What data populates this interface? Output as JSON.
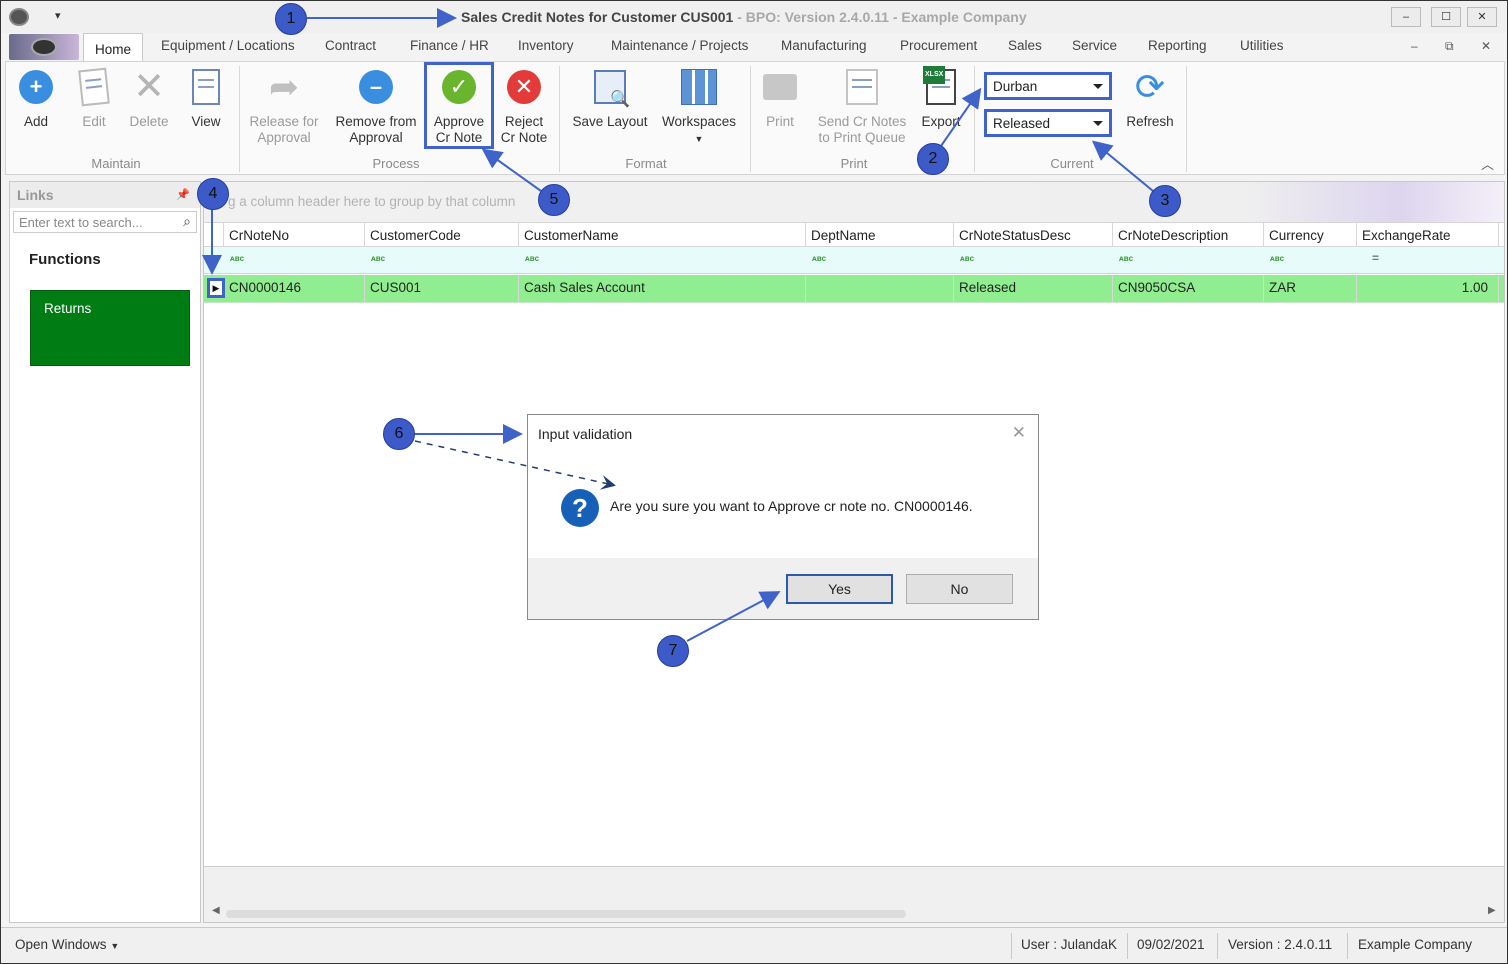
{
  "window": {
    "title_main": "Sales Credit Notes for Customer CUS001",
    "title_rest": " - BPO: Version 2.4.0.11 - Example Company",
    "quick_access": "▾",
    "controls": [
      "–",
      "☐",
      "✕"
    ]
  },
  "tabs": [
    "Home",
    "Equipment / Locations",
    "Contract",
    "Finance / HR",
    "Inventory",
    "Maintenance / Projects",
    "Manufacturing",
    "Procurement",
    "Sales",
    "Service",
    "Reporting",
    "Utilities"
  ],
  "mdi_controls": [
    "–",
    "⧉",
    "✕"
  ],
  "ribbon": {
    "maintain": {
      "label": "Maintain",
      "add": "Add",
      "edit": "Edit",
      "delete": "Delete",
      "view": "View"
    },
    "process": {
      "label": "Process",
      "release_1": "Release for",
      "release_2": "Approval",
      "remove_1": "Remove from",
      "remove_2": "Approval",
      "approve_1": "Approve",
      "approve_2": "Cr Note",
      "reject_1": "Reject",
      "reject_2": "Cr Note"
    },
    "format": {
      "label": "Format",
      "save_layout": "Save Layout",
      "workspaces": "Workspaces"
    },
    "print": {
      "label": "Print",
      "print": "Print",
      "send_1": "Send Cr Notes",
      "send_2": "to Print Queue",
      "export": "Export",
      "xlsx": "XLSX"
    },
    "current": {
      "label": "Current",
      "site": "Durban",
      "status": "Released",
      "refresh": "Refresh"
    }
  },
  "links": {
    "header": "Links",
    "search_placeholder": "Enter text to search...",
    "functions": "Functions",
    "returns": "Returns"
  },
  "grid": {
    "group_hint": "g a column header here to group by that column",
    "columns": [
      "CrNoteNo",
      "CustomerCode",
      "CustomerName",
      "DeptName",
      "CrNoteStatusDesc",
      "CrNoteDescription",
      "Currency",
      "ExchangeRate"
    ],
    "filter_text": "ᴀʙᴄ",
    "filter_eq": "=",
    "rows": [
      {
        "CrNoteNo": "CN0000146",
        "CustomerCode": "CUS001",
        "CustomerName": "Cash Sales Account",
        "DeptName": "",
        "CrNoteStatusDesc": "Released",
        "CrNoteDescription": "CN9050CSA",
        "Currency": "ZAR",
        "ExchangeRate": "1.00"
      }
    ]
  },
  "status_bar": {
    "open_windows": "Open Windows",
    "user": "User : JulandaK",
    "date": "09/02/2021",
    "version": "Version : 2.4.0.11",
    "company": "Example Company"
  },
  "dialog": {
    "title": "Input validation",
    "message": "Are you sure you want to Approve cr note no. CN0000146.",
    "yes": "Yes",
    "no": "No"
  },
  "annotations": [
    "1",
    "2",
    "3",
    "4",
    "5",
    "6",
    "7"
  ],
  "colors": {
    "accent_blue": "#3f63c8",
    "row_selected": "#90ee90",
    "returns_tile": "#007c14",
    "approve_green": "#6ab52e",
    "reject_red": "#e33a3a"
  }
}
